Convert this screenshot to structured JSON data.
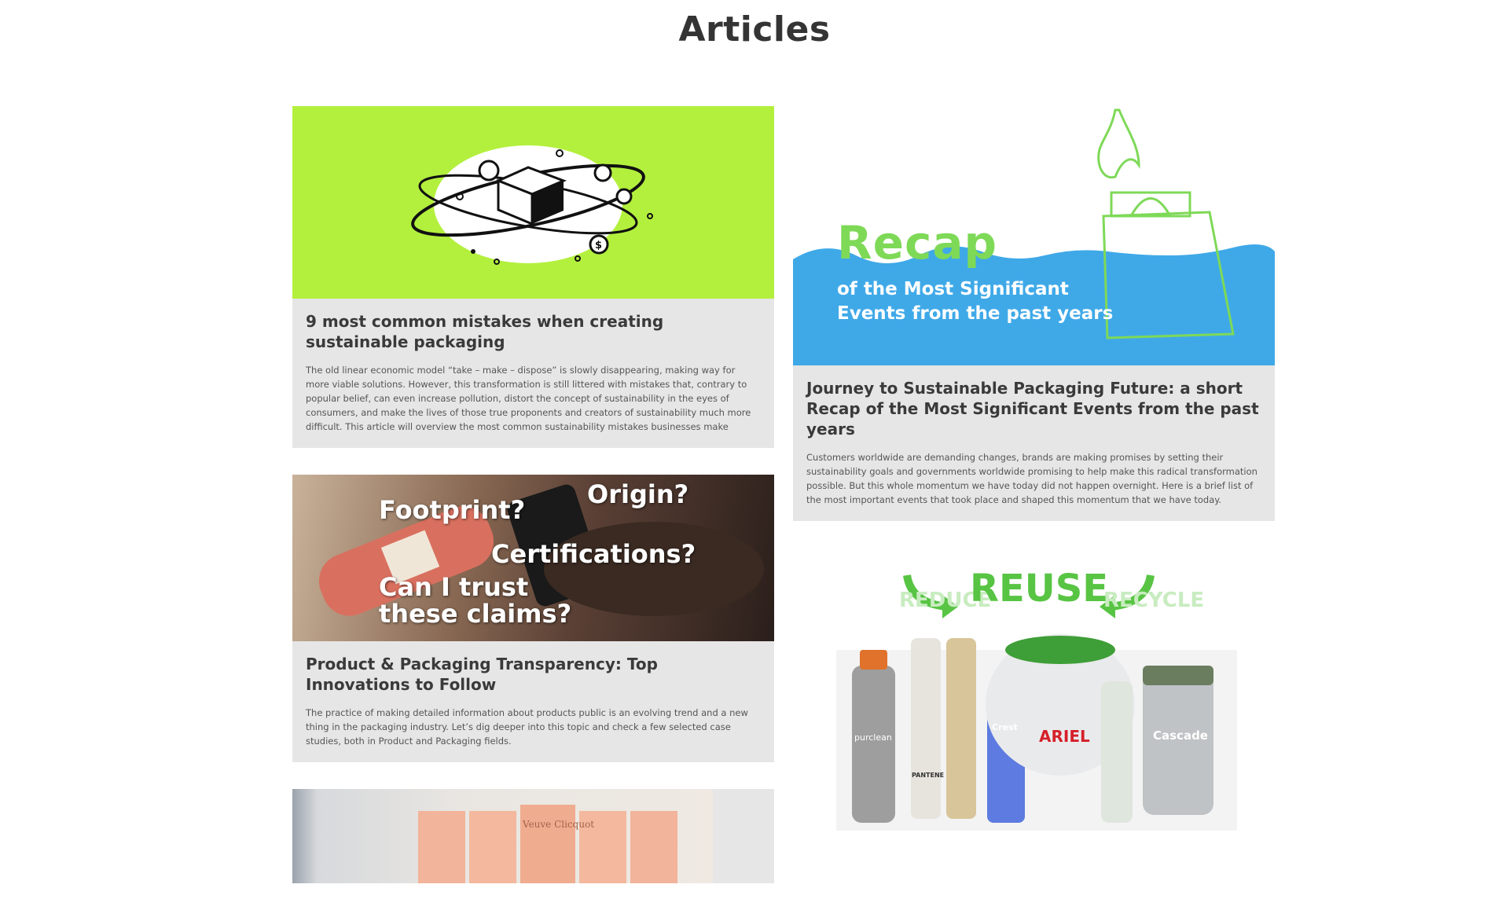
{
  "page": {
    "title": "Articles"
  },
  "colors": {
    "lime": "#b3f03d",
    "wave_blue": "#3fa9e8",
    "recap_green": "#7ed957",
    "reuse_green": "#58c444",
    "card_bg": "#e6e6e6"
  },
  "articles": [
    {
      "title": "9 most common mistakes when creating sustainable packaging",
      "excerpt": "The old linear economic model “take – make – dispose” is slowly disappearing, making way for more viable solutions. However, this transformation is still littered with mistakes that, contrary to popular belief, can even increase pollution, distort the concept of sustainability in the eyes of consumers, and make the lives of those true proponents and creators of sustainability much more difficult. This article will overview the most common sustainability mistakes businesses make",
      "image": {
        "icon": "box-orbit-illustration"
      }
    },
    {
      "title": "Journey to Sustainable Packaging Future: a short Recap of the Most Significant Events from the past years",
      "excerpt": "Customers worldwide are demanding changes, brands are making promises by setting their sustainability goals and governments worldwide promising to help make this radical transformation possible. But this whole momentum we have today did not happen overnight. Here is a brief list of the most important events that took place and shaped this momentum that we have today.",
      "image": {
        "heading": "Recap",
        "line1": "of the Most Significant",
        "line2": "Events from the past years"
      }
    },
    {
      "title": "Product & Packaging Transparency: Top Innovations to Follow",
      "excerpt": "The practice of making detailed information about products public is an evolving trend and a new thing in the packaging industry. Let’s dig deeper into this topic and check a few selected case studies, both in Product and Packaging fields.",
      "image": {
        "q1": "Footprint?",
        "q2": "Origin?",
        "q3": "Certifications?",
        "q4a": "Can I trust",
        "q4b": "these claims?"
      }
    },
    {
      "title": "",
      "excerpt": "",
      "image": {
        "reuse": "REUSE",
        "reduce": "REDUCE",
        "recycle": "RECYCLE",
        "brand1": "ARIEL",
        "brand2": "Cascade",
        "brand3": "Crest",
        "brand4": "PANTENE",
        "brand5": "purclean"
      }
    },
    {
      "title": "",
      "excerpt": "",
      "image": {
        "label": "Veuve Clicquot"
      }
    }
  ]
}
